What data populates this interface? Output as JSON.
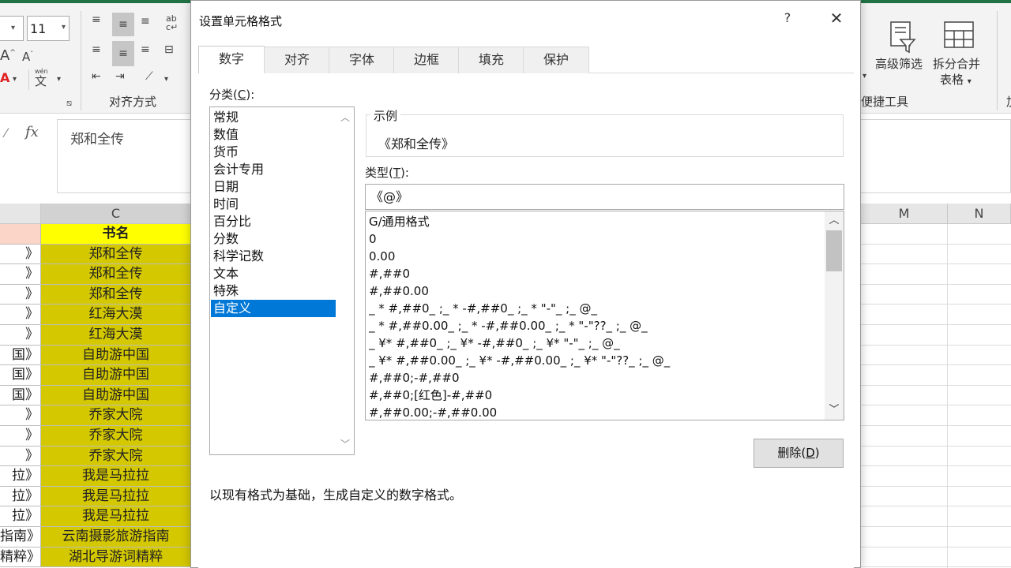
{
  "ribbon": {
    "font_size": "11",
    "alignment_group_label": "对齐方式",
    "wen_label": "wén",
    "wen_char": "文",
    "advanced_filter_label": "高级筛选",
    "split_merge_label_1": "拆分合并",
    "split_merge_label_2": "表格",
    "quick_tools_label": "便捷工具",
    "far_right_label": "加"
  },
  "formula_bar": {
    "fx": "fx",
    "content": "郑和全传"
  },
  "grid": {
    "col_c": "C",
    "col_m": "M",
    "col_n": "N",
    "col_b_cells": [
      "",
      "》",
      "》",
      "》",
      "》",
      "》",
      "国》",
      "国》",
      "国》",
      "》",
      "》",
      "》",
      "拉》",
      "拉》",
      "拉》",
      "指南》",
      "精粹》"
    ],
    "col_c_cells": [
      "书名",
      "郑和全传",
      "郑和全传",
      "郑和全传",
      "红海大漠",
      "红海大漠",
      "自助游中国",
      "自助游中国",
      "自助游中国",
      "乔家大院",
      "乔家大院",
      "乔家大院",
      "我是马拉拉",
      "我是马拉拉",
      "我是马拉拉",
      "云南摄影旅游指南",
      "湖北导游词精粹"
    ]
  },
  "dialog": {
    "title": "设置单元格格式",
    "help": "?",
    "close": "✕",
    "tabs": [
      "数字",
      "对齐",
      "字体",
      "边框",
      "填充",
      "保护"
    ],
    "active_tab": "数字",
    "category_label": "分类(",
    "category_key": "C",
    "category_label_end": "):",
    "categories": [
      "常规",
      "数值",
      "货币",
      "会计专用",
      "日期",
      "时间",
      "百分比",
      "分数",
      "科学记数",
      "文本",
      "特殊",
      "自定义"
    ],
    "selected_category": "自定义",
    "sample_label": "示例",
    "sample_value": "《郑和全传》",
    "type_label": "类型(",
    "type_key": "T",
    "type_label_end": "):",
    "type_value": "《@》",
    "formats": [
      "G/通用格式",
      "0",
      "0.00",
      "#,##0",
      "#,##0.00",
      "_ * #,##0_ ;_ * -#,##0_ ;_ * \"-\"_ ;_ @_",
      "_ * #,##0.00_ ;_ * -#,##0.00_ ;_ * \"-\"??_ ;_ @_",
      "_ ¥* #,##0_ ;_ ¥* -#,##0_ ;_ ¥* \"-\"_ ;_ @_",
      "_ ¥* #,##0.00_ ;_ ¥* -#,##0.00_ ;_ ¥* \"-\"??_ ;_ @_",
      "#,##0;-#,##0",
      "#,##0;[红色]-#,##0",
      "#,##0.00;-#,##0.00"
    ],
    "delete_label": "删除(",
    "delete_key": "D",
    "delete_label_end": ")",
    "description": "以现有格式为基础，生成自定义的数字格式。"
  },
  "colors": {
    "accent": "#0078d7",
    "excel_green": "#217346",
    "header_yellow": "#ffff00",
    "cell_olive": "#d4c800",
    "header_peach": "#fbd5c8"
  }
}
